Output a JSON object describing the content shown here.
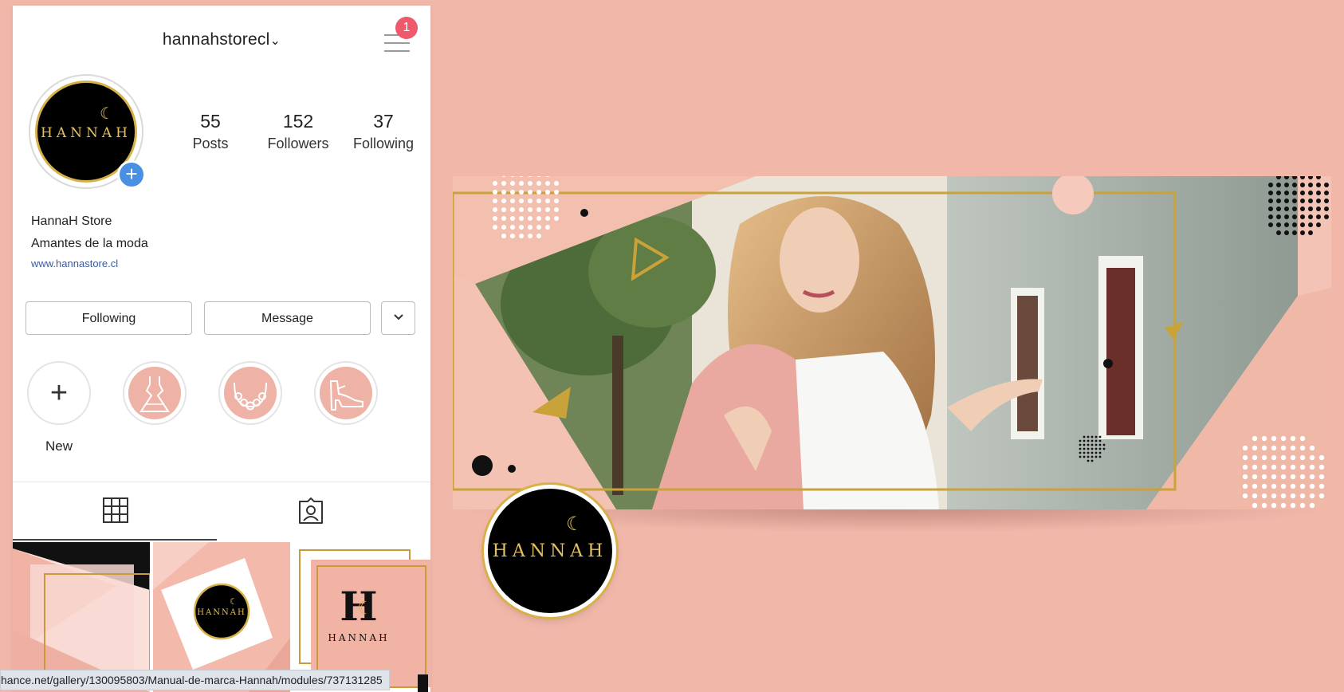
{
  "profile": {
    "username": "hannahstorecl",
    "notification_count": "1",
    "avatar_text": "HANNAH",
    "avatar_moon": "☾",
    "add_symbol": "+",
    "stats": {
      "posts_value": "55",
      "posts_label": "Posts",
      "followers_value": "152",
      "followers_label": "Followers",
      "following_value": "37",
      "following_label": "Following"
    },
    "bio": {
      "name": "HannaH Store",
      "description": "Amantes de la moda",
      "link": "www.hannastore.cl"
    },
    "buttons": {
      "following": "Following",
      "message": "Message"
    },
    "highlights": {
      "new_label": "New",
      "new_symbol": "+",
      "items": [
        "dress-icon",
        "necklace-icon",
        "shoe-icon"
      ]
    },
    "grid_post_text": "HANNAH"
  },
  "banner": {
    "logo_text": "HANNAH",
    "logo_moon": "☾"
  },
  "statusbar": {
    "url": "hance.net/gallery/130095803/Manual-de-marca-Hannah/modules/737131285"
  },
  "colors": {
    "background": "#f1b8aa",
    "gold": "#d7b24a",
    "pink": "#eeb3a6",
    "link": "#3b5b9a",
    "badge": "#ee5a6b",
    "add_blue": "#4a90e2"
  }
}
